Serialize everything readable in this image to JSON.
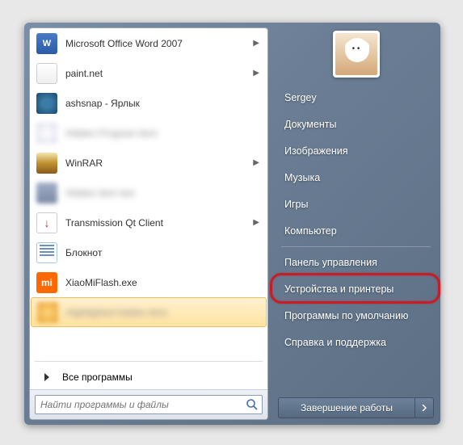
{
  "programs": [
    {
      "label": "Microsoft Office Word 2007",
      "arrow": true,
      "icon": "ic-word",
      "iconText": "W",
      "blur": false
    },
    {
      "label": "paint.net",
      "arrow": true,
      "icon": "ic-paint",
      "iconText": "",
      "blur": false
    },
    {
      "label": "ashsnap - Ярлык",
      "arrow": false,
      "icon": "ic-ash",
      "iconText": "",
      "blur": false
    },
    {
      "label": "Hidden Program Item",
      "arrow": false,
      "icon": "ic-blur1",
      "iconText": "",
      "blur": true
    },
    {
      "label": "WinRAR",
      "arrow": true,
      "icon": "ic-winrar",
      "iconText": "",
      "blur": false
    },
    {
      "label": "Hidden item two",
      "arrow": false,
      "icon": "ic-blur2",
      "iconText": "",
      "blur": true
    },
    {
      "label": "Transmission Qt Client",
      "arrow": true,
      "icon": "ic-trans",
      "iconText": "↓",
      "blur": false
    },
    {
      "label": "Блокнот",
      "arrow": false,
      "icon": "ic-notepad",
      "iconText": "",
      "blur": false
    },
    {
      "label": "XiaoMiFlash.exe",
      "arrow": false,
      "icon": "ic-xiaomi",
      "iconText": "mi",
      "blur": false
    },
    {
      "label": "Highlighted hidden item",
      "arrow": false,
      "icon": "ic-blur3",
      "iconText": "",
      "blur": true,
      "highlight": true
    }
  ],
  "all_programs": "Все программы",
  "search_placeholder": "Найти программы и файлы",
  "right_items": [
    "Sergey",
    "Документы",
    "Изображения",
    "Музыка",
    "Игры",
    "Компьютер",
    "Панель управления",
    "Устройства и принтеры",
    "Программы по умолчанию",
    "Справка и поддержка"
  ],
  "right_separators_after": [
    5
  ],
  "highlighted_right_index": 7,
  "shutdown_label": "Завершение работы"
}
